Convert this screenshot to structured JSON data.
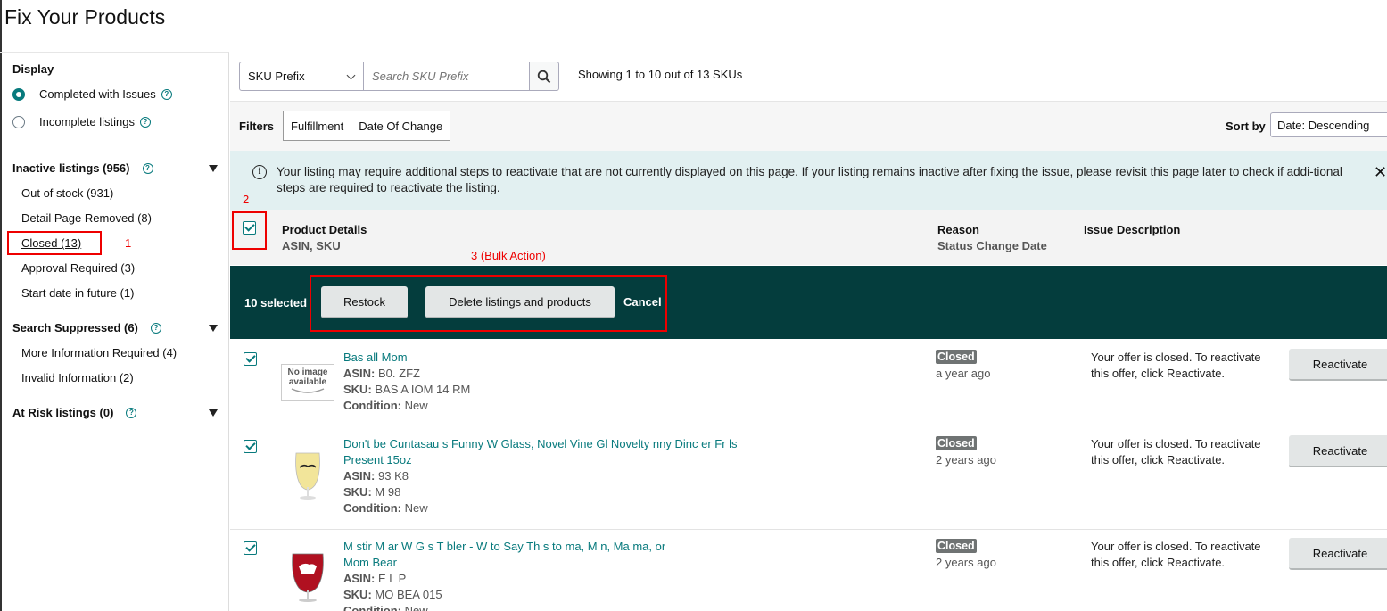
{
  "page": {
    "title": "Fix Your Products"
  },
  "sidebar": {
    "display_label": "Display",
    "radios": [
      {
        "label": "Completed with Issues",
        "selected": true
      },
      {
        "label": "Incomplete listings",
        "selected": false
      }
    ],
    "groups": [
      {
        "label": "Inactive listings (956)",
        "items": [
          {
            "label": "Out of stock (931)"
          },
          {
            "label": "Detail Page Removed (8)"
          },
          {
            "label": "Closed (13)",
            "active": true
          },
          {
            "label": "Approval Required (3)"
          },
          {
            "label": "Start date in future (1)"
          }
        ]
      },
      {
        "label": "Search Suppressed (6)",
        "items": [
          {
            "label": "More Information Required (4)"
          },
          {
            "label": "Invalid Information (2)"
          }
        ]
      },
      {
        "label": "At Risk listings (0)",
        "items": []
      }
    ],
    "help_glyph": "?"
  },
  "annotations": {
    "one": "1",
    "two": "2",
    "three": "3 (Bulk Action)"
  },
  "search": {
    "select_value": "SKU Prefix",
    "placeholder": "Search SKU Prefix",
    "showing": "Showing 1 to 10 out of 13 SKUs"
  },
  "filters": {
    "label": "Filters",
    "buttons": [
      "Fulfillment",
      "Date Of Change"
    ],
    "sort_label": "Sort by",
    "sort_value": "Date: Descending"
  },
  "banner": {
    "icon_glyph": "i",
    "text": "Your listing may require additional steps to reactivate that are not currently displayed on this page. If your listing remains inactive after fixing the issue, please revisit this page later to check if addi-tional steps are required to reactivate the listing.",
    "close_glyph": "✕"
  },
  "table_header": {
    "product_details": "Product Details",
    "asin_sku": "ASIN, SKU",
    "reason": "Reason",
    "status_change_date": "Status Change Date",
    "issue_description": "Issue Description"
  },
  "bulk": {
    "selected": "10 selected",
    "restock": "Restock",
    "delete": "Delete listings and products",
    "cancel": "Cancel"
  },
  "rows": [
    {
      "title": "Bas    all Mom",
      "asin_label": "ASIN:",
      "asin": "B0.  ZFZ",
      "sku_label": "SKU:",
      "sku": "BAS   A   IOM   14   RM",
      "condition_label": "Condition:",
      "condition": "New",
      "status": "Closed",
      "ago": "a year ago",
      "issue": "Your offer is closed. To reactivate this offer, click Reactivate.",
      "action": "Reactivate",
      "no_image_line1": "No image",
      "no_image_line2": "available"
    },
    {
      "title": "       Don't be  Cuntasau    s Funny W      Glass, Novel      Vine Gl      Novelty     nny Dinc     er Fr     ls",
      "title2": "Present 15oz",
      "asin_label": "ASIN:",
      "asin": "    93    K8",
      "sku_label": "SKU:",
      "sku": "M      98",
      "condition_label": "Condition:",
      "condition": "New",
      "status": "Closed",
      "ago": "2 years ago",
      "issue": "Your offer is closed. To reactivate this offer, click Reactivate.",
      "action": "Reactivate"
    },
    {
      "title": "M    stir M      ar W    G    s T   bler -      W    to Say Th    s to      ma, M    n, Ma      ma, or",
      "title2": "Mom      Bear",
      "asin_label": "ASIN:",
      "asin": "E    L    P",
      "sku_label": "SKU:",
      "sku": "MO    BEA    015",
      "condition_label": "Condition:",
      "condition": "New",
      "status": "Closed",
      "ago": "2 years ago",
      "issue": "Your offer is closed. To reactivate this offer, click Reactivate.",
      "action": "Reactivate"
    }
  ]
}
